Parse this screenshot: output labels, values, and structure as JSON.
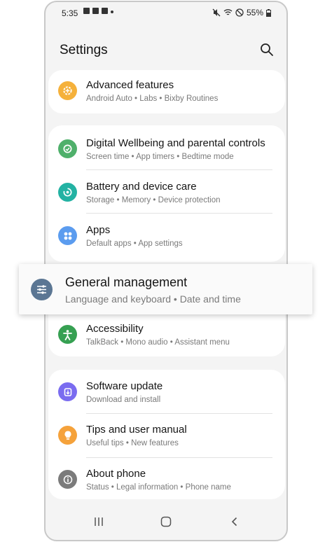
{
  "status_bar": {
    "time": "5:35",
    "battery": "55%"
  },
  "header": {
    "title": "Settings"
  },
  "items": [
    {
      "title": "Advanced features",
      "subtitle": "Android Auto  •  Labs  •  Bixby Routines",
      "icon": "gear-plus-icon",
      "color": "#f5b13b"
    },
    {
      "title": "Digital Wellbeing and parental controls",
      "subtitle": "Screen time  •  App timers  •  Bedtime mode",
      "icon": "wellbeing-icon",
      "color": "#4fb06b"
    },
    {
      "title": "Battery and device care",
      "subtitle": "Storage  •  Memory  •  Device protection",
      "icon": "device-care-icon",
      "color": "#23b2a3"
    },
    {
      "title": "Apps",
      "subtitle": "Default apps  •  App settings",
      "icon": "apps-grid-icon",
      "color": "#5b9cef"
    },
    {
      "title": "Accessibility",
      "subtitle": "TalkBack  •  Mono audio  •  Assistant menu",
      "icon": "accessibility-icon",
      "color": "#36a052"
    },
    {
      "title": "Software update",
      "subtitle": "Download and install",
      "icon": "software-update-icon",
      "color": "#7a6cf0"
    },
    {
      "title": "Tips and user manual",
      "subtitle": "Useful tips  •  New features",
      "icon": "lightbulb-icon",
      "color": "#f5a23b"
    },
    {
      "title": "About phone",
      "subtitle": "Status  •  Legal information  •  Phone name",
      "icon": "info-icon",
      "color": "#7b7b7b"
    }
  ],
  "highlight": {
    "title": "General management",
    "subtitle": "Language and keyboard  •  Date and time",
    "icon": "sliders-icon",
    "color": "#5b7693"
  }
}
